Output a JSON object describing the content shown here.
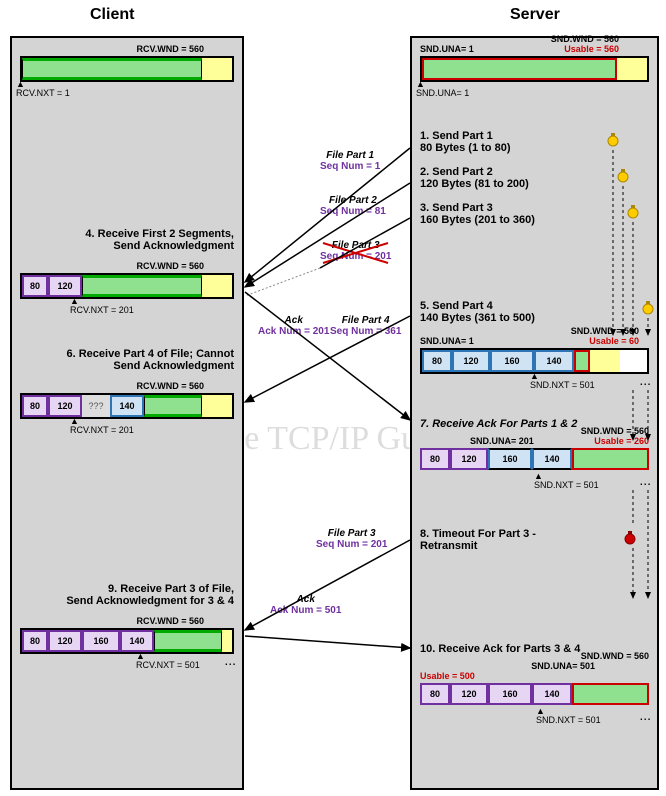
{
  "titles": {
    "client": "Client",
    "server": "Server"
  },
  "watermark": "The TCP/IP Guide",
  "client": {
    "w1": {
      "rcvwnd": "RCV.WND = 560",
      "rcvnxt": "RCV.NXT = 1"
    },
    "step4": "4. Receive First 2 Segments,\nSend Acknowledgment",
    "w2": {
      "rcvwnd": "RCV.WND = 560",
      "rcvnxt": "RCV.NXT = 201",
      "seg1": "80",
      "seg2": "120"
    },
    "step6": "6. Receive Part 4 of File; Cannot\nSend Acknowledgment",
    "w3": {
      "rcvwnd": "RCV.WND = 560",
      "rcvnxt": "RCV.NXT = 201",
      "seg1": "80",
      "seg2": "120",
      "gap": "???",
      "seg4": "140"
    },
    "step9": "9. Receive Part 3 of File,\nSend Acknowledgment for 3 & 4",
    "w4": {
      "rcvwnd": "RCV.WND = 560",
      "rcvnxt": "RCV.NXT = 501",
      "seg1": "80",
      "seg2": "120",
      "seg3": "160",
      "seg4": "140"
    }
  },
  "server": {
    "w1": {
      "snduna": "SND.UNA= 1",
      "sndwnd": "SND.WND = 560",
      "usable": "Usable = 560",
      "snduna2": "SND.UNA= 1"
    },
    "step1": "1. Send Part 1\n80 Bytes (1 to 80)",
    "step2": "2. Send Part 2\n120 Bytes (81 to 200)",
    "step3": "3. Send Part 3\n160 Bytes (201 to 360)",
    "step5": "5. Send Part 4\n140 Bytes (361 to 500)",
    "w2": {
      "snduna": "SND.UNA= 1",
      "sndwnd": "SND.WND = 560",
      "usable": "Usable = 60",
      "sndnxt": "SND.NXT = 501",
      "seg1": "80",
      "seg2": "120",
      "seg3": "160",
      "seg4": "140"
    },
    "step7": "7. Receive Ack For Parts 1 & 2",
    "w3": {
      "snduna": "SND.UNA= 201",
      "sndwnd": "SND.WND = 560",
      "usable": "Usable = 260",
      "sndnxt": "SND.NXT = 501",
      "seg1": "80",
      "seg2": "120",
      "seg3": "160",
      "seg4": "140"
    },
    "step8": "8. Timeout For Part 3 -\nRetransmit",
    "step10": "10. Receive Ack for Parts 3 & 4",
    "w4": {
      "snduna": "SND.UNA= 501",
      "sndwnd": "SND.WND = 560",
      "usable": "Usable = 500",
      "sndnxt": "SND.NXT = 501",
      "seg1": "80",
      "seg2": "120",
      "seg3": "160",
      "seg4": "140"
    }
  },
  "messages": {
    "fp1": {
      "label": "File Part 1",
      "seq": "Seq Num = 1"
    },
    "fp2": {
      "label": "File Part 2",
      "seq": "Seq Num = 81"
    },
    "fp3": {
      "label": "File Part 3",
      "seq": "Seq Num = 201"
    },
    "fp4": {
      "label": "File Part 4",
      "seq": "Seq Num = 361"
    },
    "ack1": {
      "label": "Ack",
      "ack": "Ack Num = 201"
    },
    "fp3r": {
      "label": "File Part 3",
      "seq": "Seq Num = 201"
    },
    "ack2": {
      "label": "Ack",
      "ack": "Ack Num = 501"
    }
  }
}
